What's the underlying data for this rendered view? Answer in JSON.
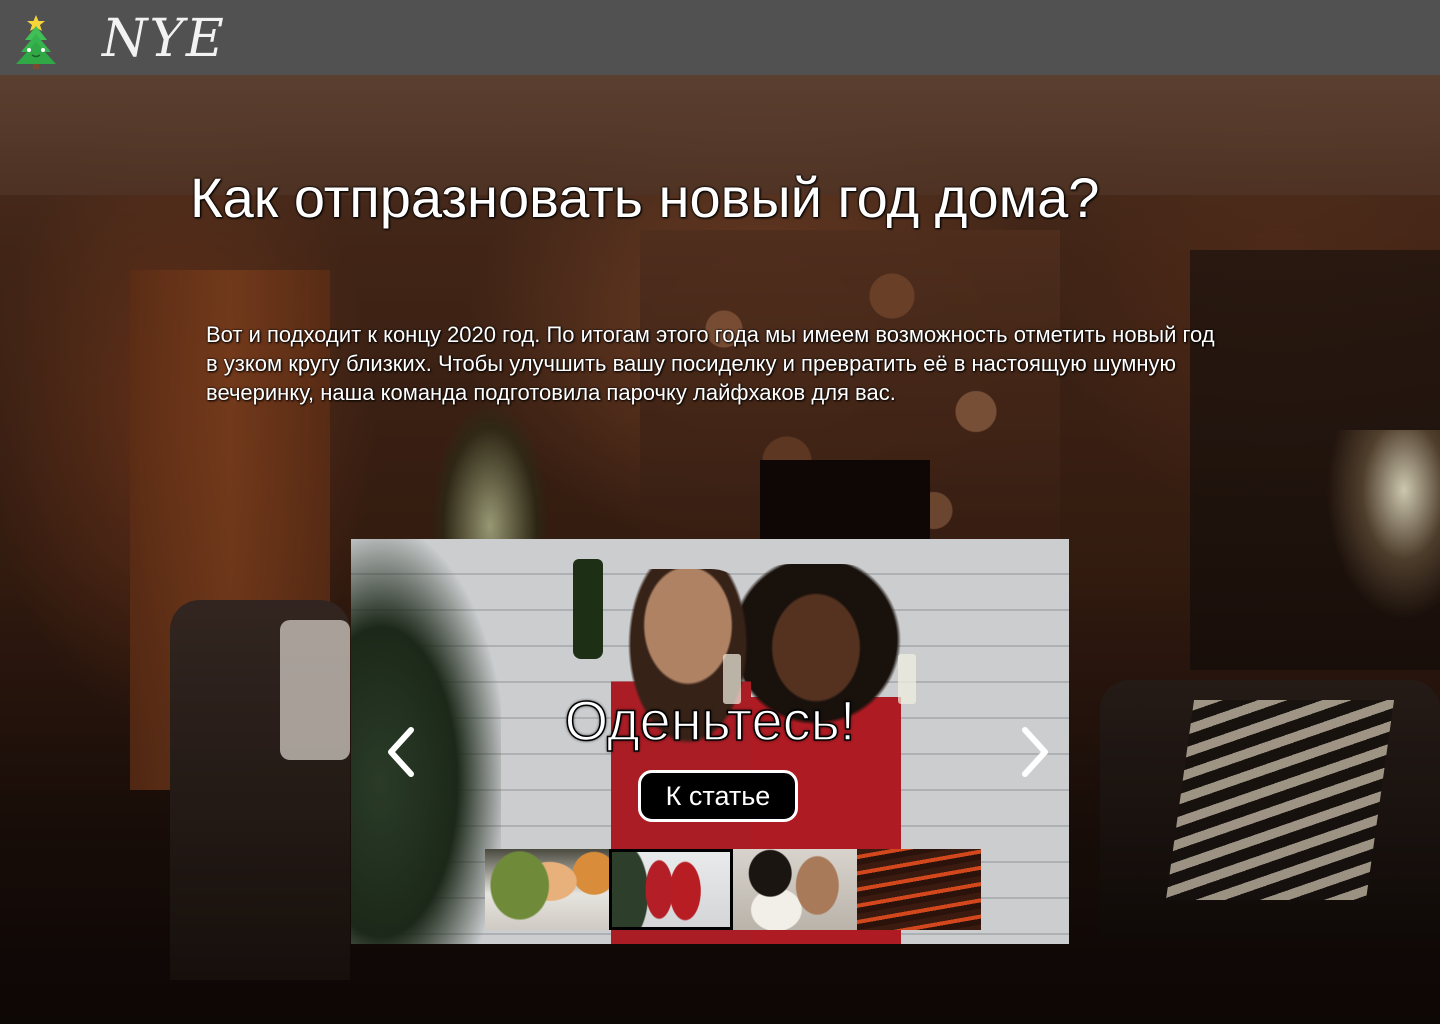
{
  "header": {
    "logo_icon": "christmas-tree-icon",
    "brand": "NYE"
  },
  "hero": {
    "title": "Как отпразновать новый год дома?",
    "intro": "Вот и подходит к концу 2020 год. По итогам этого года мы имеем возможность отметить новый год в узком кругу близких. Чтобы улучшить вашу посиделку и превратить её в настоящую шумную вечеринку, наша команда подготовила парочку лайфхаков для вас."
  },
  "carousel": {
    "slide_title": "Оденьтесь!",
    "button_label": "К статье",
    "prev_icon": "chevron-left-icon",
    "next_icon": "chevron-right-icon",
    "thumbnails": [
      {
        "name": "thumbnail-cocktails",
        "selected": false
      },
      {
        "name": "thumbnail-outfits",
        "selected": true
      },
      {
        "name": "thumbnail-games",
        "selected": false
      },
      {
        "name": "thumbnail-grill",
        "selected": false
      }
    ]
  },
  "colors": {
    "header_bg": "#515151",
    "button_bg": "#000000",
    "button_border": "#ffffff",
    "text": "#ffffff"
  }
}
